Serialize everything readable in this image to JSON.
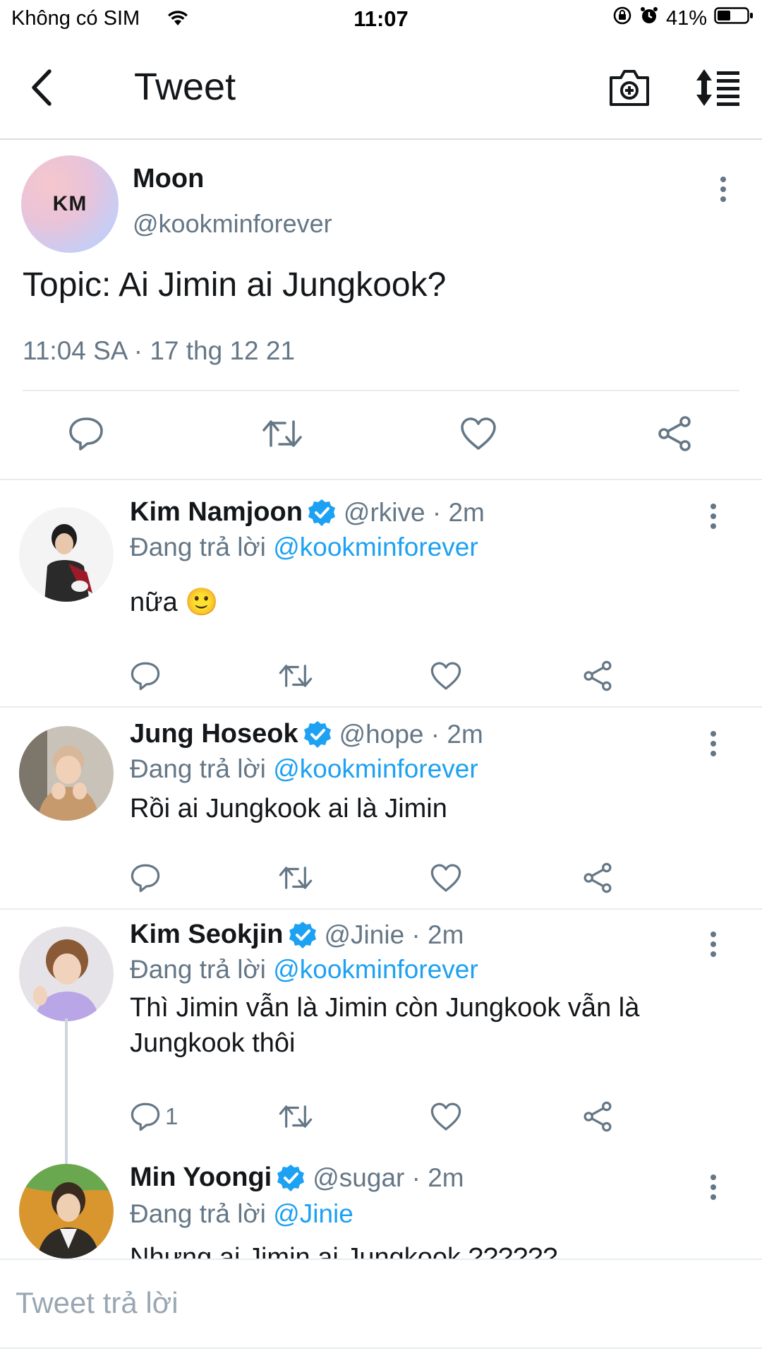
{
  "status_bar": {
    "carrier": "Không có SIM",
    "time": "11:07",
    "battery": "41%"
  },
  "nav": {
    "title": "Tweet",
    "icons": {
      "back": "chevron-left-icon",
      "camera": "camera-icon",
      "sort": "sort-icon"
    }
  },
  "main_tweet": {
    "avatar_text": "KM",
    "name": "Moon",
    "handle": "@kookminforever",
    "text": "Topic: Ai Jimin ai Jungkook?",
    "timestamp": "11:04 SA · 17 thg 12 21"
  },
  "replies": [
    {
      "name": "Kim Namjoon",
      "handle": "@rkive · 2m",
      "replying_prefix": "Đang trả lời ",
      "replying_to": "@kookminforever",
      "text": "nữa 🙂",
      "reply_count": ""
    },
    {
      "name": "Jung Hoseok",
      "handle": "@hope · 2m",
      "replying_prefix": "Đang trả lời ",
      "replying_to": "@kookminforever",
      "text": "Rồi ai Jungkook ai là Jimin",
      "reply_count": ""
    },
    {
      "name": "Kim Seokjin",
      "handle": "@Jinie · 2m",
      "replying_prefix": "Đang trả lời ",
      "replying_to": "@kookminforever",
      "text": "Thì Jimin vẫn là Jimin còn Jungkook vẫn là Jungkook thôi",
      "reply_count": "1"
    },
    {
      "name": "Min Yoongi",
      "handle": "@sugar · 2m",
      "replying_prefix": "Đang trả lời ",
      "replying_to": "@Jinie",
      "text": "Nhưng ai Jimin ai Jungkook ??????",
      "reply_count": ""
    }
  ],
  "composer": {
    "placeholder": "Tweet trả lời"
  },
  "colors": {
    "accent": "#1da1f2",
    "secondary_text": "#657786",
    "icon": "#657786"
  }
}
